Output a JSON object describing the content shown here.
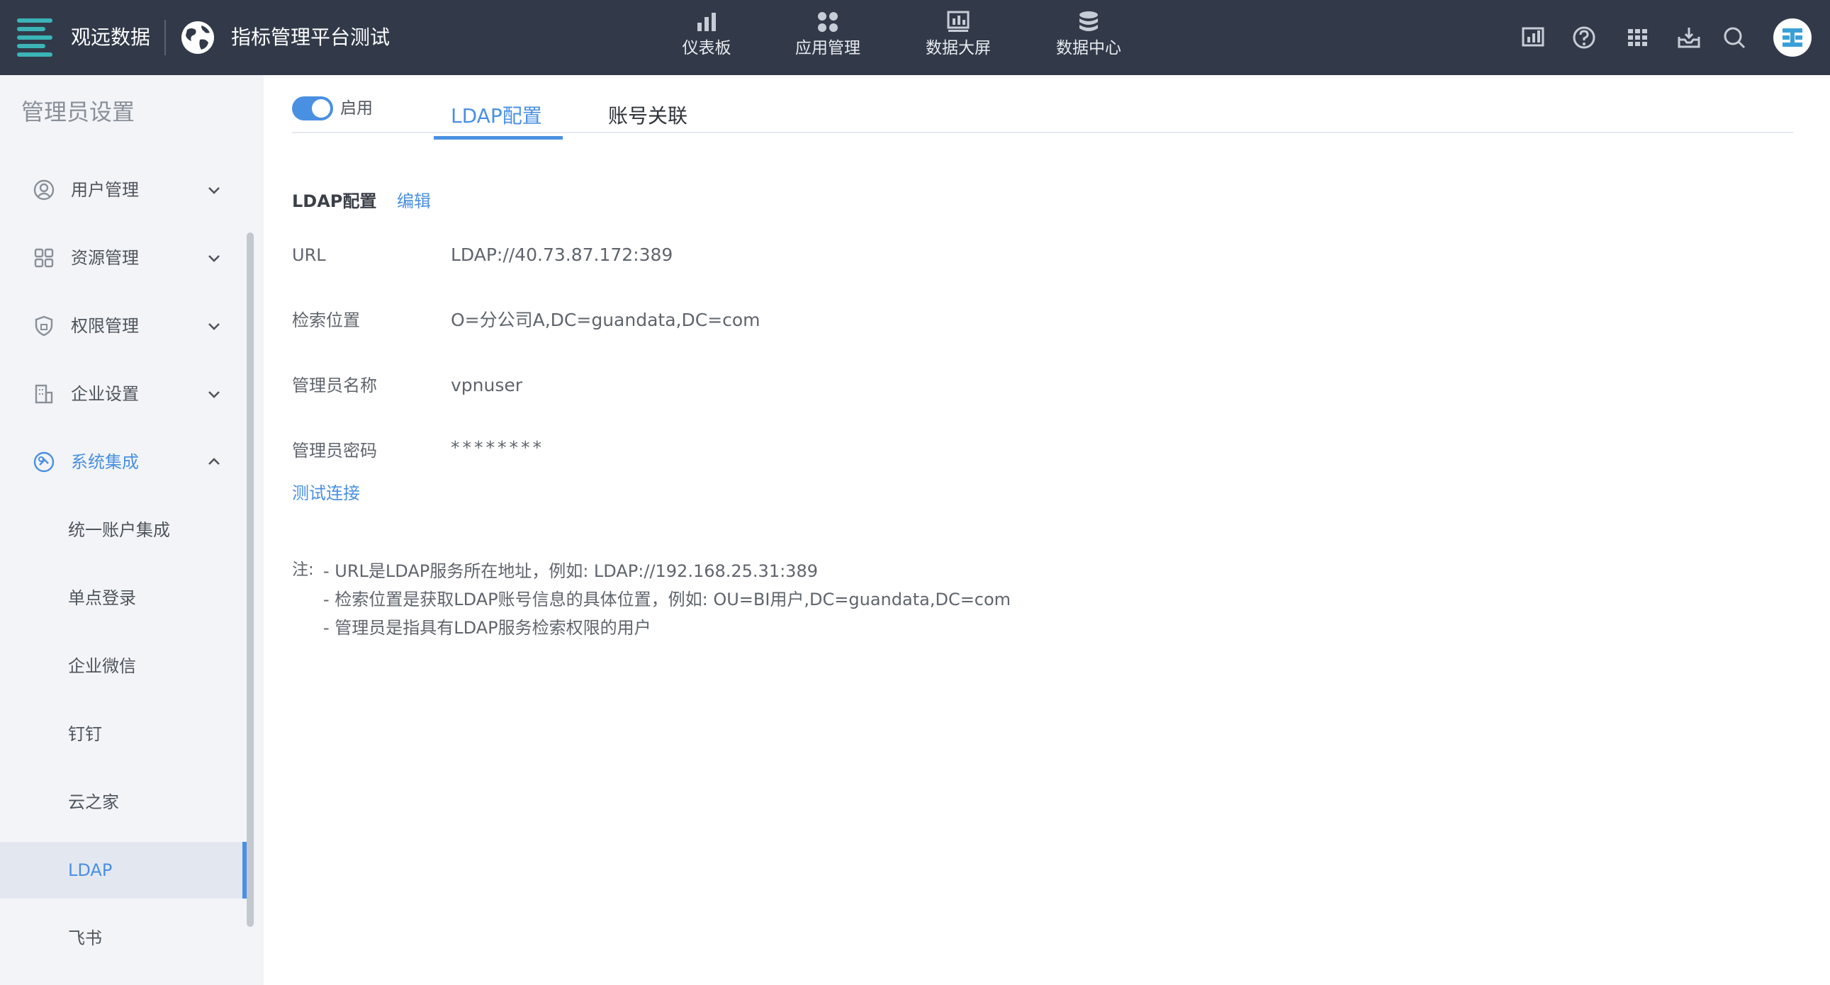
{
  "topbar": {
    "brand": "观远数据",
    "project": "指标管理平台测试",
    "nav": [
      {
        "label": "仪表板",
        "icon": "bar-chart-icon"
      },
      {
        "label": "应用管理",
        "icon": "apps-grid-icon"
      },
      {
        "label": "数据大屏",
        "icon": "screen-chart-icon"
      },
      {
        "label": "数据中心",
        "icon": "database-icon"
      }
    ],
    "tools": [
      "report-icon",
      "help-icon",
      "app-launcher-icon",
      "inbox-icon",
      "search-icon"
    ],
    "colors": {
      "background": "#323a49",
      "accent": "#3bb4b8"
    }
  },
  "sidebar": {
    "title": "管理员设置",
    "groups": [
      {
        "label": "用户管理",
        "icon": "user-icon"
      },
      {
        "label": "资源管理",
        "icon": "resource-icon"
      },
      {
        "label": "权限管理",
        "icon": "shield-icon"
      },
      {
        "label": "企业设置",
        "icon": "building-icon"
      },
      {
        "label": "系统集成",
        "icon": "integration-icon"
      }
    ],
    "sub_items": [
      "统一账户集成",
      "单点登录",
      "企业微信",
      "钉钉",
      "云之家",
      "LDAP",
      "飞书"
    ],
    "selected": "LDAP",
    "colors": {
      "active": "#4a90e2"
    }
  },
  "content": {
    "toggle_label": "启用",
    "tabs": [
      "LDAP配置",
      "账号关联"
    ],
    "section_title": "LDAP配置",
    "edit_label": "编辑",
    "fields": [
      {
        "label": "URL",
        "value": "LDAP://40.73.87.172:389"
      },
      {
        "label": "检索位置",
        "value": "O=分公司A,DC=guandata,DC=com"
      },
      {
        "label": "管理员名称",
        "value": "vpnuser"
      },
      {
        "label": "管理员密码",
        "value": "********"
      }
    ],
    "test_link": "测试连接",
    "note_prefix": "注:",
    "notes": [
      "- URL是LDAP服务所在地址，例如: LDAP://192.168.25.31:389",
      "- 检索位置是获取LDAP账号信息的具体位置，例如: OU=BI用户,DC=guandata,DC=com",
      "- 管理员是指具有LDAP服务检索权限的用户"
    ]
  }
}
